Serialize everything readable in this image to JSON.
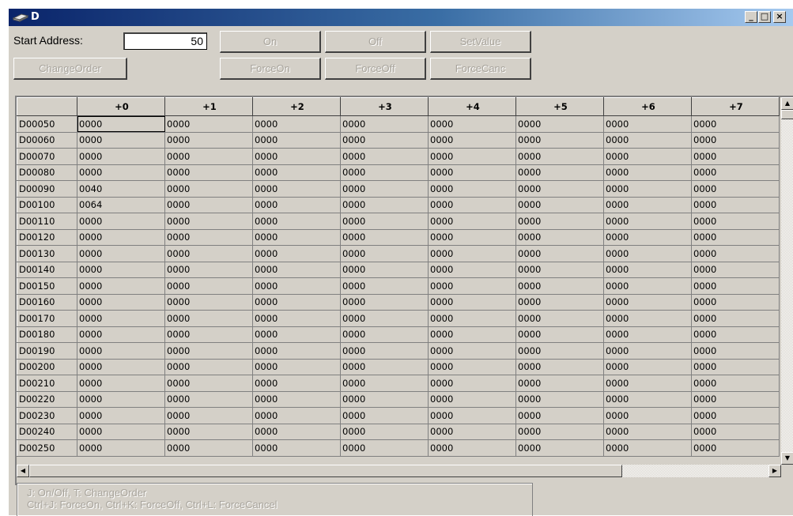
{
  "window": {
    "title": "D"
  },
  "controls": {
    "start_address_label": "Start Address:",
    "start_address_value": "50",
    "buttons": {
      "on": "On",
      "off": "Off",
      "setvalue": "SetValue",
      "changeorder": "ChangeOrder",
      "forceon": "ForceOn",
      "forceoff": "ForceOff",
      "forcecanc": "ForceCanc"
    }
  },
  "grid": {
    "columns": [
      "+0",
      "+1",
      "+2",
      "+3",
      "+4",
      "+5",
      "+6",
      "+7"
    ],
    "rows": [
      {
        "addr": "D00050",
        "values": [
          "0000",
          "0000",
          "0000",
          "0000",
          "0000",
          "0000",
          "0000",
          "0000"
        ]
      },
      {
        "addr": "D00060",
        "values": [
          "0000",
          "0000",
          "0000",
          "0000",
          "0000",
          "0000",
          "0000",
          "0000"
        ]
      },
      {
        "addr": "D00070",
        "values": [
          "0000",
          "0000",
          "0000",
          "0000",
          "0000",
          "0000",
          "0000",
          "0000"
        ]
      },
      {
        "addr": "D00080",
        "values": [
          "0000",
          "0000",
          "0000",
          "0000",
          "0000",
          "0000",
          "0000",
          "0000"
        ]
      },
      {
        "addr": "D00090",
        "values": [
          "0040",
          "0000",
          "0000",
          "0000",
          "0000",
          "0000",
          "0000",
          "0000"
        ]
      },
      {
        "addr": "D00100",
        "values": [
          "0064",
          "0000",
          "0000",
          "0000",
          "0000",
          "0000",
          "0000",
          "0000"
        ]
      },
      {
        "addr": "D00110",
        "values": [
          "0000",
          "0000",
          "0000",
          "0000",
          "0000",
          "0000",
          "0000",
          "0000"
        ]
      },
      {
        "addr": "D00120",
        "values": [
          "0000",
          "0000",
          "0000",
          "0000",
          "0000",
          "0000",
          "0000",
          "0000"
        ]
      },
      {
        "addr": "D00130",
        "values": [
          "0000",
          "0000",
          "0000",
          "0000",
          "0000",
          "0000",
          "0000",
          "0000"
        ]
      },
      {
        "addr": "D00140",
        "values": [
          "0000",
          "0000",
          "0000",
          "0000",
          "0000",
          "0000",
          "0000",
          "0000"
        ]
      },
      {
        "addr": "D00150",
        "values": [
          "0000",
          "0000",
          "0000",
          "0000",
          "0000",
          "0000",
          "0000",
          "0000"
        ]
      },
      {
        "addr": "D00160",
        "values": [
          "0000",
          "0000",
          "0000",
          "0000",
          "0000",
          "0000",
          "0000",
          "0000"
        ]
      },
      {
        "addr": "D00170",
        "values": [
          "0000",
          "0000",
          "0000",
          "0000",
          "0000",
          "0000",
          "0000",
          "0000"
        ]
      },
      {
        "addr": "D00180",
        "values": [
          "0000",
          "0000",
          "0000",
          "0000",
          "0000",
          "0000",
          "0000",
          "0000"
        ]
      },
      {
        "addr": "D00190",
        "values": [
          "0000",
          "0000",
          "0000",
          "0000",
          "0000",
          "0000",
          "0000",
          "0000"
        ]
      },
      {
        "addr": "D00200",
        "values": [
          "0000",
          "0000",
          "0000",
          "0000",
          "0000",
          "0000",
          "0000",
          "0000"
        ]
      },
      {
        "addr": "D00210",
        "values": [
          "0000",
          "0000",
          "0000",
          "0000",
          "0000",
          "0000",
          "0000",
          "0000"
        ]
      },
      {
        "addr": "D00220",
        "values": [
          "0000",
          "0000",
          "0000",
          "0000",
          "0000",
          "0000",
          "0000",
          "0000"
        ]
      },
      {
        "addr": "D00230",
        "values": [
          "0000",
          "0000",
          "0000",
          "0000",
          "0000",
          "0000",
          "0000",
          "0000"
        ]
      },
      {
        "addr": "D00240",
        "values": [
          "0000",
          "0000",
          "0000",
          "0000",
          "0000",
          "0000",
          "0000",
          "0000"
        ]
      },
      {
        "addr": "D00250",
        "values": [
          "0000",
          "0000",
          "0000",
          "0000",
          "0000",
          "0000",
          "0000",
          "0000"
        ]
      }
    ]
  },
  "help": {
    "line1": "J: On/Off,   T: ChangeOrder",
    "line2": "Ctrl+J: ForceOn,   Ctrl+K: ForceOff,   Ctrl+L: ForceCancel"
  },
  "icons": {
    "window_icon": "plc-module-icon",
    "minimize": "minimize-icon",
    "maximize": "maximize-icon",
    "close": "close-icon"
  }
}
